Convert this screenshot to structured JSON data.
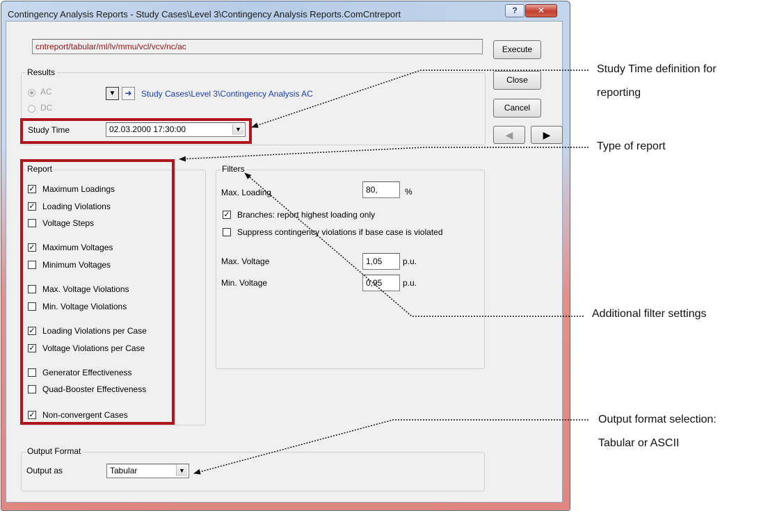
{
  "window": {
    "title": "Contingency Analysis Reports - Study Cases\\Level 3\\Contingency Analysis Reports.ComCntreport",
    "help_label": "?",
    "close_label": "✕"
  },
  "command_line": "cntreport/tabular/ml/lv/mmu/vcl/vcv/nc/ac",
  "buttons": {
    "execute": "Execute",
    "close": "Close",
    "cancel": "Cancel",
    "nav_prev": "◀",
    "nav_next": "▶"
  },
  "results": {
    "label": "Results",
    "ac_label": "AC",
    "dc_label": "DC",
    "selected": "AC",
    "link_text": "Study Cases\\Level 3\\Contingency Analysis AC",
    "select_icon": "▼",
    "jump_icon": "➜"
  },
  "study_time": {
    "label": "Study Time",
    "value": "02.03.2000 17:30:00",
    "arrow": "▼"
  },
  "report": {
    "label": "Report",
    "items": [
      {
        "label": "Maximum Loadings",
        "checked": true
      },
      {
        "label": "Loading Violations",
        "checked": true
      },
      {
        "label": "Voltage Steps",
        "checked": false
      },
      {
        "label": "Maximum Voltages",
        "checked": true
      },
      {
        "label": "Minimum Voltages",
        "checked": false
      },
      {
        "label": "Max. Voltage Violations",
        "checked": false
      },
      {
        "label": "Min. Voltage Violations",
        "checked": false
      },
      {
        "label": "Loading Violations per Case",
        "checked": true
      },
      {
        "label": "Voltage Violations per Case",
        "checked": true
      },
      {
        "label": "Generator Effectiveness",
        "checked": false
      },
      {
        "label": "Quad-Booster Effectiveness",
        "checked": false
      },
      {
        "label": "Non-convergent Cases",
        "checked": true
      }
    ]
  },
  "filters": {
    "label": "Filters",
    "max_loading_label": "Max. Loading",
    "max_loading_value": "80,",
    "max_loading_unit": "%",
    "branches_label": "Branches: report highest loading only",
    "branches_checked": true,
    "suppress_label": "Suppress contingency violations if base case is violated",
    "suppress_checked": false,
    "max_voltage_label": "Max. Voltage",
    "max_voltage_value": "1,05",
    "max_voltage_unit": "p.u.",
    "min_voltage_label": "Min. Voltage",
    "min_voltage_value": "0,95",
    "min_voltage_unit": "p.u."
  },
  "output_format": {
    "label": "Output Format",
    "output_as_label": "Output as",
    "value": "Tabular",
    "arrow": "▼"
  },
  "annotations": {
    "study_time_line1": "Study Time definition for",
    "study_time_line2": "reporting",
    "type_of_report": "Type of report",
    "filter_settings": "Additional filter settings",
    "output_line1": "Output format selection:",
    "output_line2": "Tabular or ASCII"
  },
  "colors": {
    "highlight_box": "#b0141c",
    "link": "#1a3fb0",
    "command_text": "#8b1a1a"
  }
}
